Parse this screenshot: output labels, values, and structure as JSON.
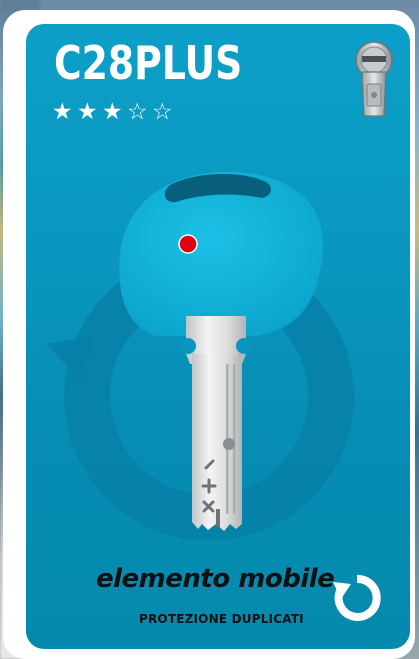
{
  "product": {
    "name": "C28PLUS",
    "rating": 3,
    "rating_max": 5,
    "stars": [
      "★",
      "★",
      "★",
      "☆",
      "☆"
    ]
  },
  "feature": {
    "title": "elemento mobile",
    "caption": "PROTEZIONE DUPLICATI"
  },
  "icons": {
    "cylinder": "lock-cylinder-icon",
    "refresh": "refresh-icon",
    "rotate_arrow": "rotate-arrow-icon"
  },
  "colors": {
    "panel": "#0a97bf",
    "key_head": "#18b5dc",
    "key_blade": "#d9d9d9",
    "dot": "#e10012",
    "text_dark": "#111111",
    "white": "#ffffff"
  }
}
